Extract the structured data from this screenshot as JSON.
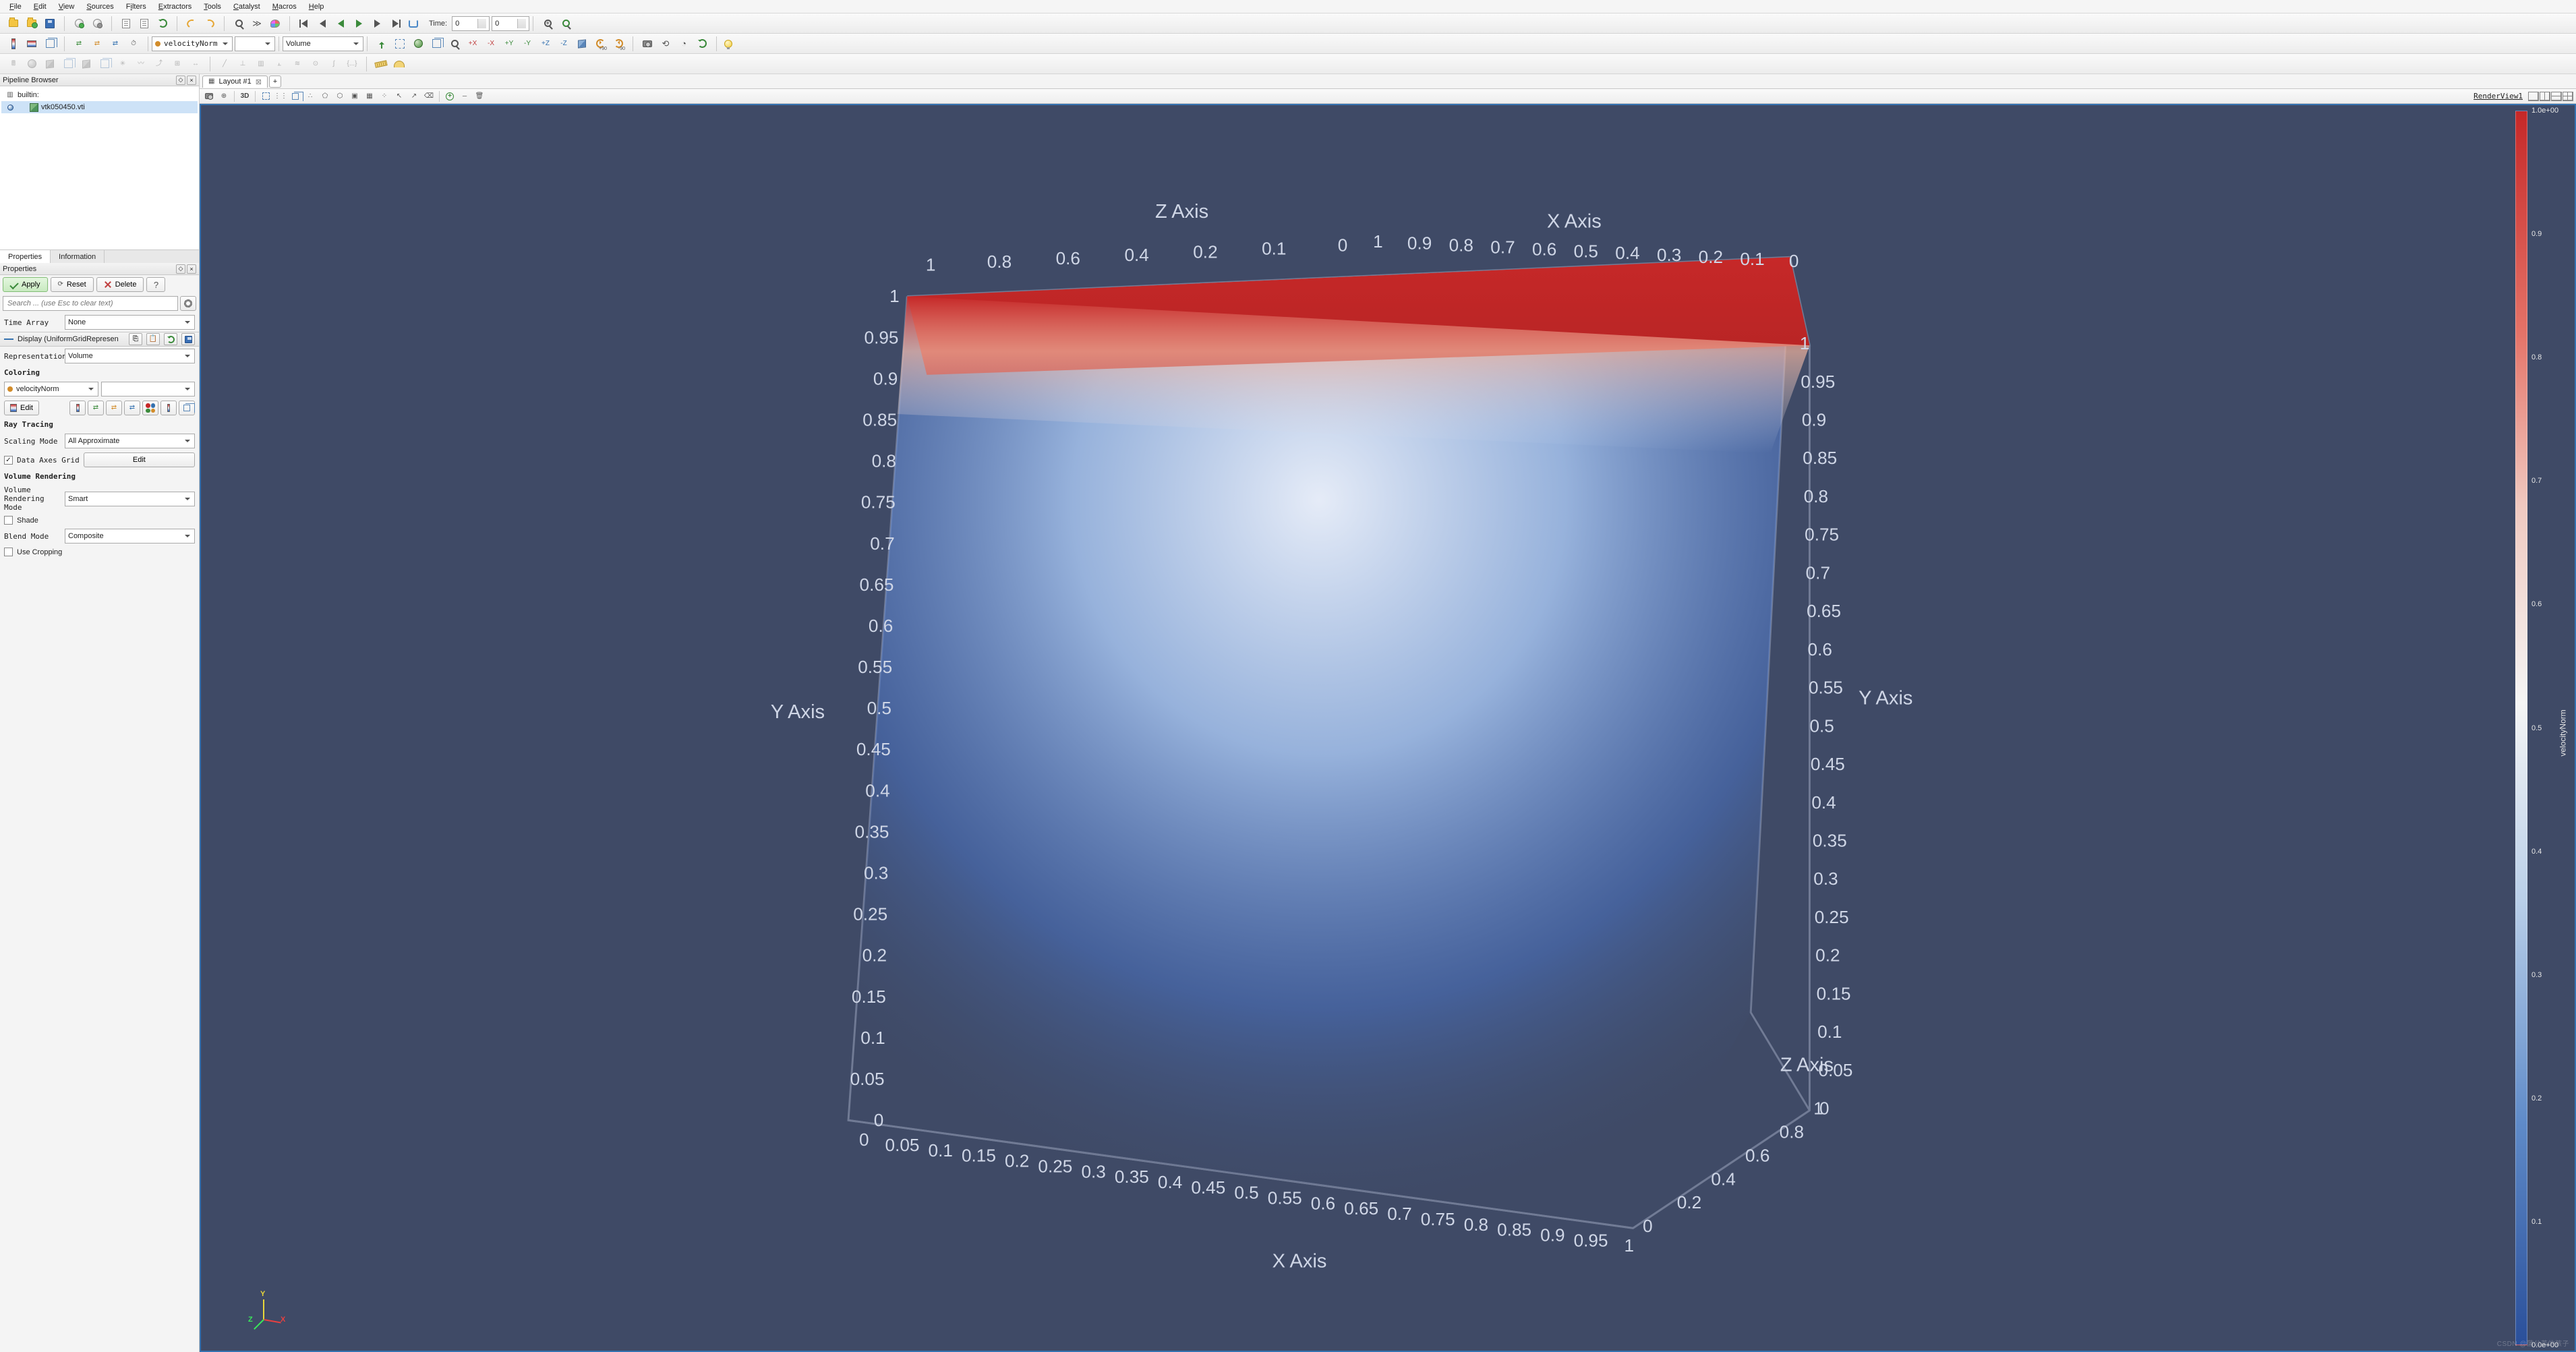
{
  "menu": [
    "File",
    "Edit",
    "View",
    "Sources",
    "Filters",
    "Extractors",
    "Tools",
    "Catalyst",
    "Macros",
    "Help"
  ],
  "menu_ul_idx": {
    "File": 0,
    "Edit": 0,
    "View": 0,
    "Sources": 0,
    "Filters": 1,
    "Extractors": 0,
    "Tools": 0,
    "Catalyst": 0,
    "Macros": 0,
    "Help": 0
  },
  "time": {
    "label": "Time:",
    "value": "0",
    "index": "0"
  },
  "active_array": "velocityNorm",
  "representation": "Volume",
  "pipeline": {
    "title": "Pipeline Browser",
    "root": "builtin:",
    "items": [
      {
        "name": "vtk050450.vti",
        "selected": true,
        "visible": true
      }
    ]
  },
  "props": {
    "tabs": [
      "Properties",
      "Information"
    ],
    "active_tab": 0,
    "panel_title": "Properties",
    "buttons": {
      "apply": "Apply",
      "reset": "Reset",
      "delete": "Delete"
    },
    "search_placeholder": "Search ... (use Esc to clear text)",
    "time_array": {
      "label": "Time Array",
      "value": "None"
    },
    "display_section": "Display (UniformGridRepresen",
    "representation": {
      "label": "Representation",
      "value": "Volume"
    },
    "coloring": {
      "heading": "Coloring",
      "array": "velocityNorm",
      "edit_btn": "Edit"
    },
    "ray_tracing": {
      "heading": "Ray Tracing",
      "scaling_label": "Scaling Mode",
      "scaling_value": "All Approximate"
    },
    "data_axes_grid": {
      "checked": true,
      "label": "Data Axes Grid",
      "edit_btn": "Edit"
    },
    "volume_rendering": {
      "heading": "Volume Rendering",
      "mode_label": "Volume Rendering Mode",
      "mode_value": "Smart",
      "shade_label": "Shade",
      "shade_checked": false,
      "blend_label": "Blend Mode",
      "blend_value": "Composite",
      "crop_label": "Use Cropping",
      "crop_checked": false
    }
  },
  "layout": {
    "tab_label": "Layout #1",
    "render_view_label": "RenderView1"
  },
  "view_axes": {
    "y": {
      "label": "Y Axis",
      "ticks": [
        "0",
        "0.05",
        "0.1",
        "0.15",
        "0.2",
        "0.25",
        "0.3",
        "0.35",
        "0.4",
        "0.45",
        "0.5",
        "0.55",
        "0.6",
        "0.65",
        "0.7",
        "0.75",
        "0.8",
        "0.85",
        "0.9",
        "0.95",
        "1"
      ]
    },
    "x_bottom": {
      "label": "X Axis",
      "ticks": [
        "0",
        "0.05",
        "0.1",
        "0.15",
        "0.2",
        "0.25",
        "0.3",
        "0.35",
        "0.4",
        "0.45",
        "0.5",
        "0.55",
        "0.6",
        "0.65",
        "0.7",
        "0.75",
        "0.8",
        "0.85",
        "0.9",
        "0.95",
        "1"
      ]
    },
    "x_top": {
      "label": "X Axis",
      "ticks": [
        "1",
        "0.9",
        "0.8",
        "0.7",
        "0.6",
        "0.5",
        "0.4",
        "0.3",
        "0.2",
        "0.1",
        "0"
      ]
    },
    "z_top": {
      "label": "Z Axis",
      "ticks": [
        "1",
        "0.8",
        "0.6",
        "0.4",
        "0.2",
        "0.1",
        "0"
      ]
    },
    "z_right": {
      "label": "Z Axis",
      "ticks": [
        "0",
        "0.2",
        "0.4",
        "0.6",
        "0.8",
        "1"
      ]
    },
    "y_right": {
      "label": "Y Axis",
      "ticks": [
        "0",
        "0.05",
        "0.1",
        "0.15",
        "0.2",
        "0.25",
        "0.3",
        "0.35",
        "0.4",
        "0.45",
        "0.5",
        "0.55",
        "0.6",
        "0.65",
        "0.7",
        "0.75",
        "0.8",
        "0.85",
        "0.9",
        "0.95",
        "1"
      ]
    }
  },
  "legend": {
    "title": "velocityNorm",
    "ticks": [
      "1.0e+00",
      "0.9",
      "0.8",
      "0.7",
      "0.6",
      "0.5",
      "0.4",
      "0.3",
      "0.2",
      "0.1",
      "0.0e+00"
    ]
  },
  "orient": {
    "x": "X",
    "y": "Y",
    "z": "Z"
  },
  "watermark": "CSDN @蒲公英的孩子"
}
